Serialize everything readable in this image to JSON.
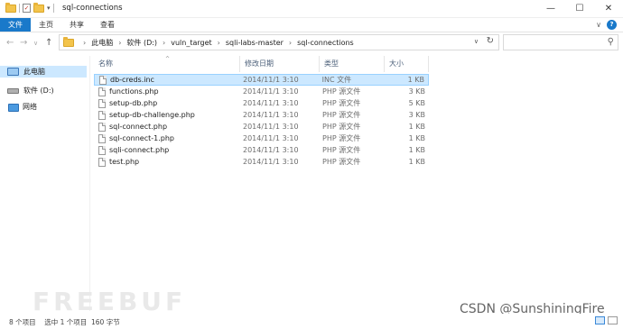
{
  "window": {
    "title": "sql-connections",
    "minimize": "—",
    "maximize": "☐",
    "close": "✕"
  },
  "ribbon": {
    "tabs": [
      "文件",
      "主页",
      "共享",
      "查看"
    ],
    "active_tab": "文件",
    "accent_color": "#1979ca"
  },
  "address": {
    "crumbs": [
      "此电脑",
      "软件 (D:)",
      "vuln_target",
      "sqli-labs-master",
      "sql-connections"
    ],
    "search_placeholder": ""
  },
  "sidebar": {
    "items": [
      {
        "label": "此电脑",
        "icon": "pc-icon",
        "selected": true
      },
      {
        "label": "软件 (D:)",
        "icon": "drive-icon",
        "selected": false
      },
      {
        "label": "网络",
        "icon": "network-icon",
        "selected": false
      }
    ]
  },
  "file_list": {
    "columns": [
      "名称",
      "修改日期",
      "类型",
      "大小"
    ],
    "files": [
      {
        "name": "db-creds.inc",
        "date": "2014/11/1 3:10",
        "type": "INC 文件",
        "size": "1 KB",
        "selected": true
      },
      {
        "name": "functions.php",
        "date": "2014/11/1 3:10",
        "type": "PHP 源文件",
        "size": "3 KB",
        "selected": false
      },
      {
        "name": "setup-db.php",
        "date": "2014/11/1 3:10",
        "type": "PHP 源文件",
        "size": "5 KB",
        "selected": false
      },
      {
        "name": "setup-db-challenge.php",
        "date": "2014/11/1 3:10",
        "type": "PHP 源文件",
        "size": "3 KB",
        "selected": false
      },
      {
        "name": "sql-connect.php",
        "date": "2014/11/1 3:10",
        "type": "PHP 源文件",
        "size": "1 KB",
        "selected": false
      },
      {
        "name": "sql-connect-1.php",
        "date": "2014/11/1 3:10",
        "type": "PHP 源文件",
        "size": "1 KB",
        "selected": false
      },
      {
        "name": "sqli-connect.php",
        "date": "2014/11/1 3:10",
        "type": "PHP 源文件",
        "size": "1 KB",
        "selected": false
      },
      {
        "name": "test.php",
        "date": "2014/11/1 3:10",
        "type": "PHP 源文件",
        "size": "1 KB",
        "selected": false
      }
    ]
  },
  "status": {
    "text": "8 个项目    选中 1 个项目  160 字节"
  },
  "watermark": "FREEBUF",
  "credit": "CSDN @SunshiningFire"
}
